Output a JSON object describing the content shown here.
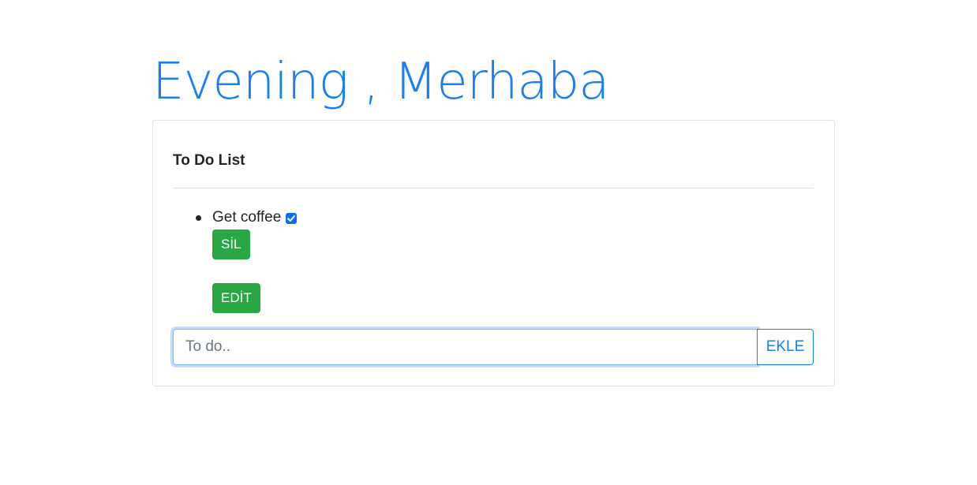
{
  "header": {
    "greeting": "Evening , Merhaba"
  },
  "card": {
    "title": "To Do List"
  },
  "todos": [
    {
      "text": "Get coffee",
      "checked": true,
      "delete_label": "SİL",
      "edit_label": "EDİT"
    }
  ],
  "form": {
    "placeholder": "To do..",
    "value": "",
    "submit_label": "EKLE"
  },
  "colors": {
    "primary": "#1a7ff2",
    "success": "#28a745",
    "checkbox": "#0b6cf5"
  }
}
